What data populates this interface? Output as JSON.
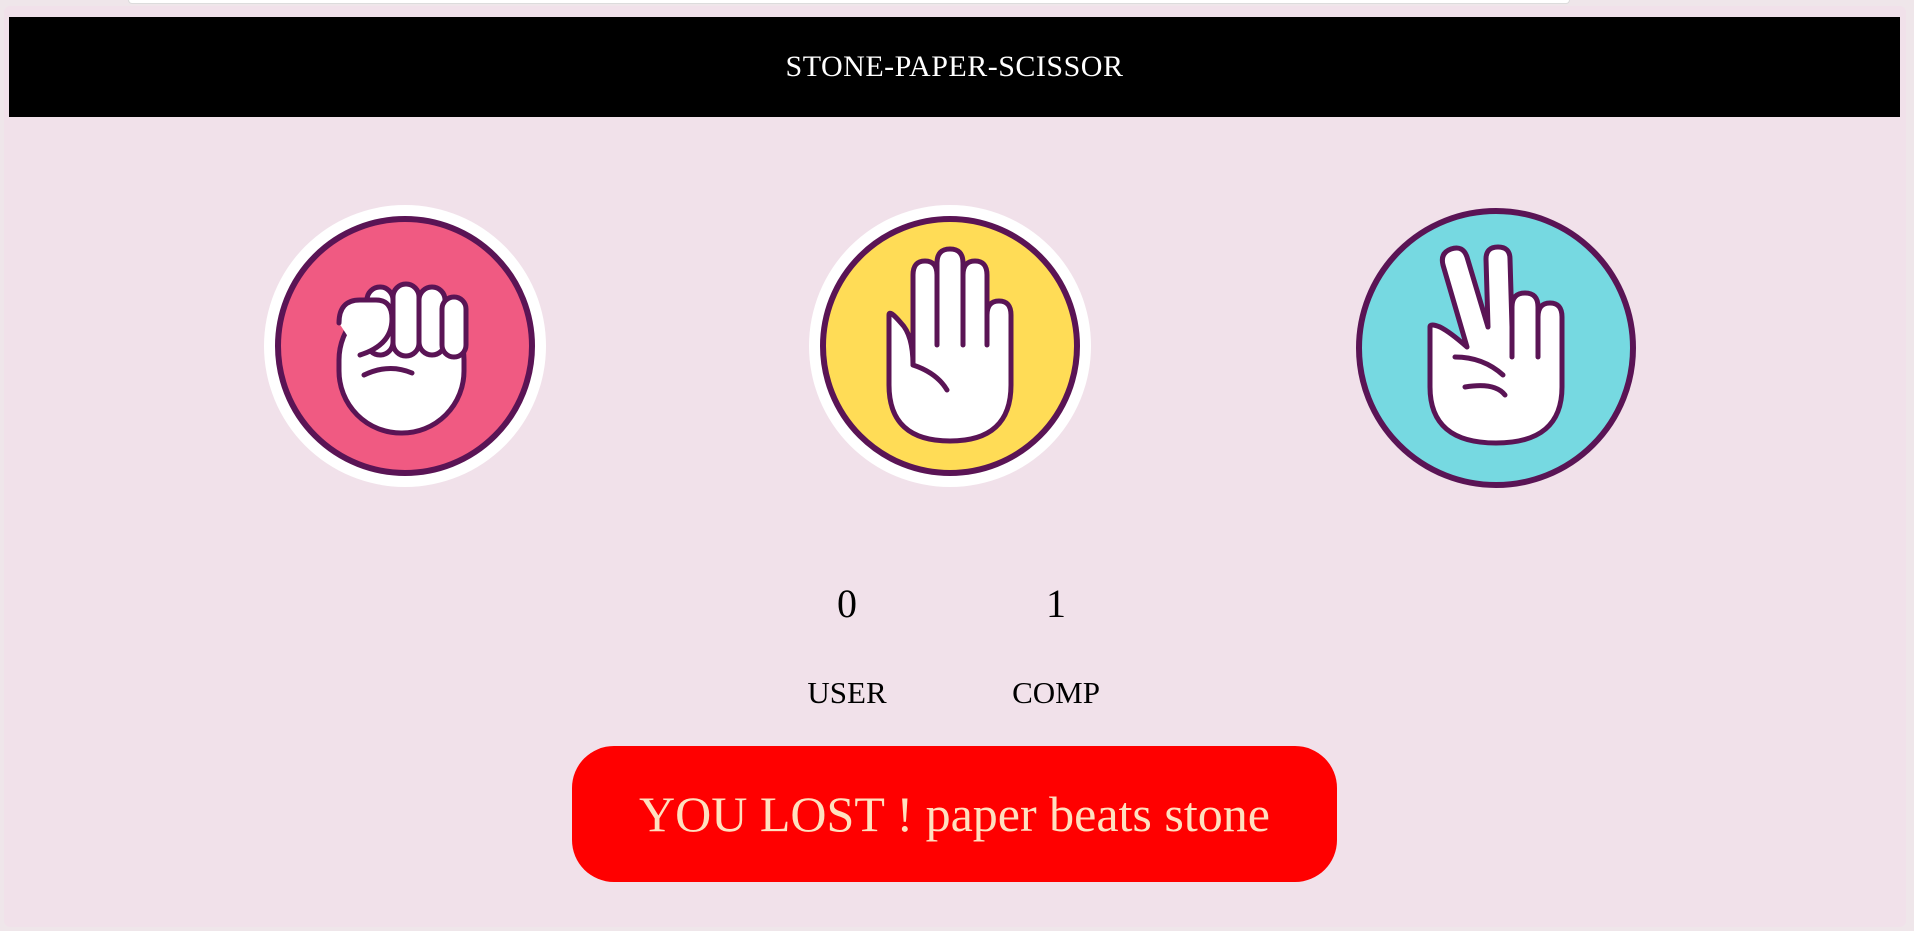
{
  "header": {
    "title": "STONE-PAPER-SCISSOR"
  },
  "choices": [
    {
      "id": "stone",
      "icon": "fist-icon",
      "color": "#f05a82"
    },
    {
      "id": "paper",
      "icon": "open-hand-icon",
      "color": "#ffdc56"
    },
    {
      "id": "scissor",
      "icon": "victory-hand-icon",
      "color": "#76d9e1"
    }
  ],
  "scoreboard": {
    "user": {
      "score": "0",
      "label": "USER"
    },
    "comp": {
      "score": "1",
      "label": "COMP"
    }
  },
  "message": {
    "text": "YOU LOST ! paper beats stone",
    "background": "#ff0000",
    "text_color": "#ffe0bf"
  },
  "colors": {
    "page_background": "#f1e1ea",
    "header_background": "#000000",
    "outline": "#5a1455"
  }
}
